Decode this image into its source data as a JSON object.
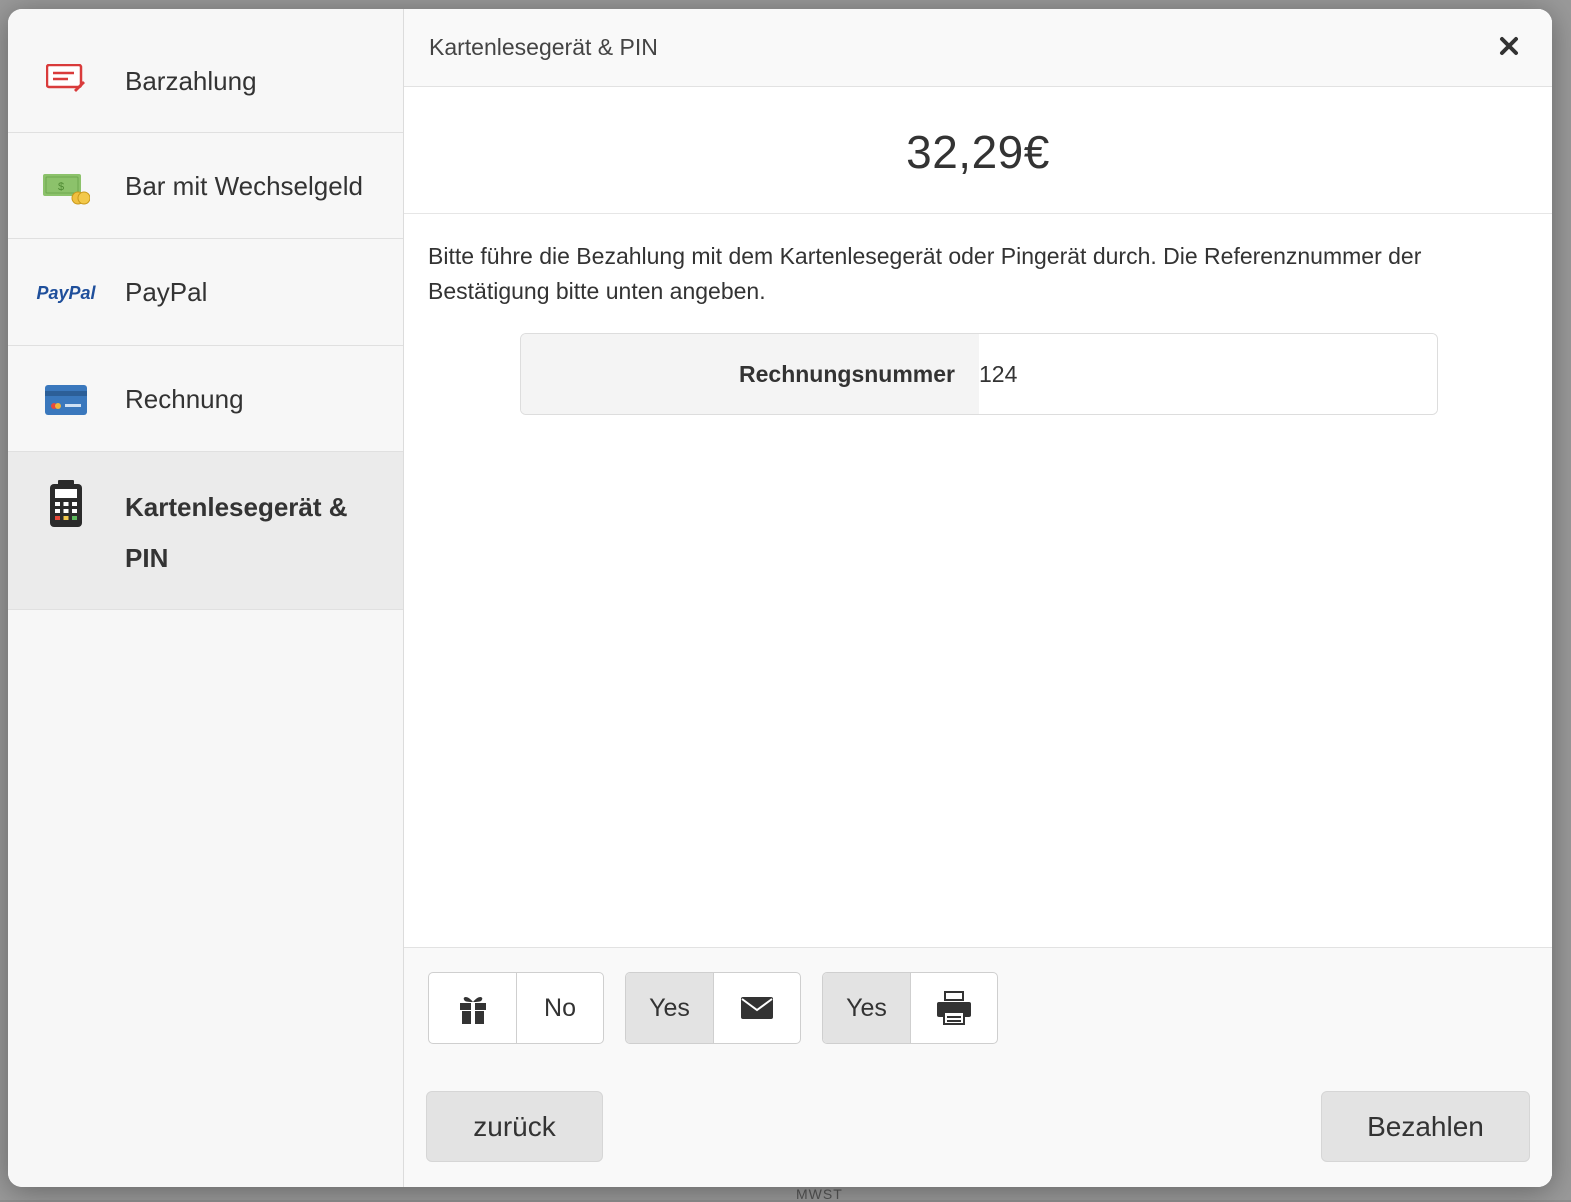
{
  "sidebar": {
    "methods": [
      {
        "label": "Barzahlung",
        "icon": "cash-note-icon"
      },
      {
        "label": "Bar mit Wechselgeld",
        "icon": "money-coins-icon"
      },
      {
        "label": "PayPal",
        "icon": "paypal-logo-icon",
        "icon_text": "PayPal"
      },
      {
        "label": "Rechnung",
        "icon": "credit-card-icon"
      },
      {
        "label": "Kartenlesegerät & PIN",
        "icon": "card-terminal-icon",
        "active": true
      }
    ]
  },
  "modal": {
    "title": "Kartenlesegerät & PIN",
    "close_icon": "close-icon"
  },
  "amount": "32,29€",
  "instructions": "Bitte führe die Bezahlung mit dem Kartenlesegerät oder Pingerät durch. Die Referenznummer der Bestätigung bitte unten angeben.",
  "reference": {
    "label": "Rechnungsnummer",
    "value": "124"
  },
  "options": {
    "gift": {
      "icon": "gift-icon",
      "value": "No"
    },
    "email": {
      "icon": "envelope-icon",
      "value": "Yes"
    },
    "print": {
      "icon": "printer-icon",
      "value": "Yes"
    }
  },
  "footer": {
    "back_label": "zurück",
    "pay_label": "Bezahlen"
  },
  "background": {
    "footer_text": "MWST"
  },
  "colors": {
    "overlay": "#8f8f8f",
    "sidebar_bg": "#f7f7f7",
    "active_bg": "#ebebeb",
    "button_bg": "#e3e3e3",
    "paypal_blue": "#1f4f9b",
    "note_red": "#d93b3b",
    "money_green": "#8cc26b",
    "card_blue": "#3a78bd"
  }
}
